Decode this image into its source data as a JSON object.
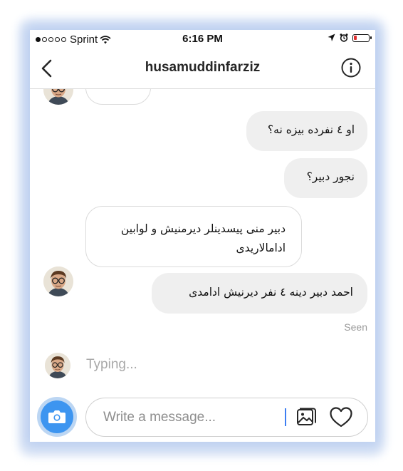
{
  "status_bar": {
    "carrier": "Sprint",
    "time": "6:16 PM",
    "signal_icon": "signal-dots-icon",
    "wifi_icon": "wifi-icon",
    "location_icon": "location-arrow-icon",
    "alarm_icon": "alarm-icon",
    "battery_icon": "battery-low-icon",
    "battery_color": "#e03030"
  },
  "header": {
    "title": "husamuddinfarziz",
    "back_icon": "chevron-left-icon",
    "info_icon": "info-icon"
  },
  "messages": [
    {
      "side": "incoming",
      "text": "...",
      "partial": true
    },
    {
      "side": "outgoing",
      "text": "او ٤ نفرده بيزه نه؟"
    },
    {
      "side": "outgoing",
      "text": "نجور دبير؟"
    },
    {
      "side": "incoming",
      "text": "دبير منى پيسدينلر ديرمنيش و لوابين ادامالاريدى"
    },
    {
      "side": "outgoing",
      "text": "احمد دبير دينه ٤ نفر ديرنيش ادامدى"
    }
  ],
  "seen_label": "Seen",
  "typing_label": "Typing...",
  "composer": {
    "placeholder": "Write a message...",
    "camera_icon": "camera-icon",
    "gallery_icon": "gallery-icon",
    "heart_icon": "heart-icon",
    "accent_color": "#3d95f0"
  }
}
